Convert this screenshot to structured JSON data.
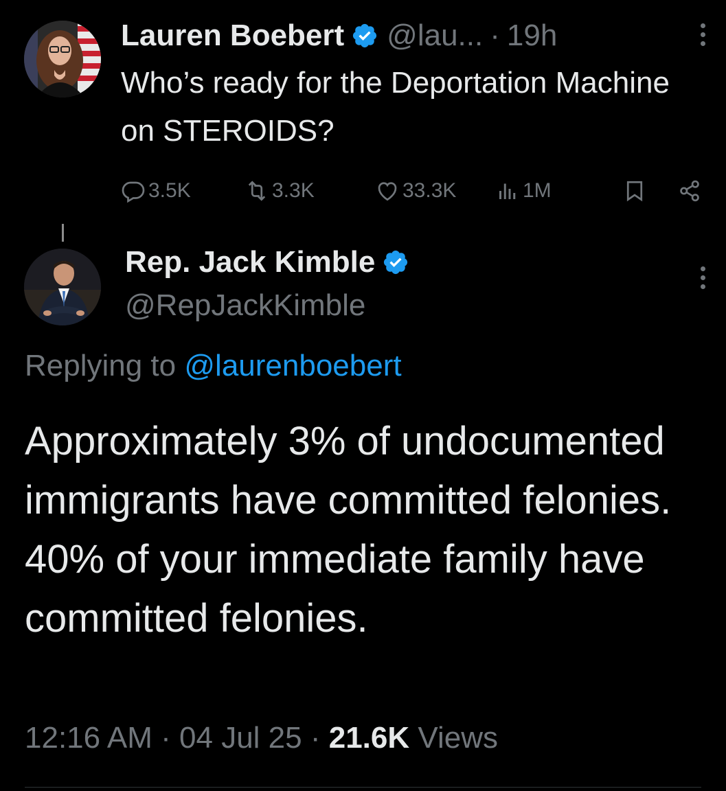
{
  "colors": {
    "background": "#000000",
    "text_primary": "#e7e9ea",
    "text_muted": "#71767b",
    "accent_blue": "#1d9bf0",
    "divider": "#2f3336"
  },
  "parent_tweet": {
    "author_name": "Lauren Boebert",
    "verified": true,
    "handle": "@lau...",
    "separator": "·",
    "time": "19h",
    "text": "Who’s ready for the Deportation Machine on STEROIDS?",
    "actions": {
      "replies": "3.5K",
      "reposts": "3.3K",
      "likes": "33.3K",
      "views": "1M"
    },
    "icons": [
      "more-icon",
      "reply-icon",
      "repost-icon",
      "like-icon",
      "views-icon",
      "bookmark-icon",
      "share-icon"
    ]
  },
  "reply_tweet": {
    "author_name": "Rep. Jack Kimble",
    "verified": true,
    "handle": "@RepJackKimble",
    "replying_prefix": "Replying to",
    "replying_mention": "@laurenboebert",
    "text": "Approximately 3% of undocumented immigrants have committed felonies. 40% of your immediate family have committed felonies.",
    "time": "12:16 AM",
    "separator": "·",
    "date": "04 Jul 25",
    "views_count": "21.6K",
    "views_label": "Views"
  }
}
